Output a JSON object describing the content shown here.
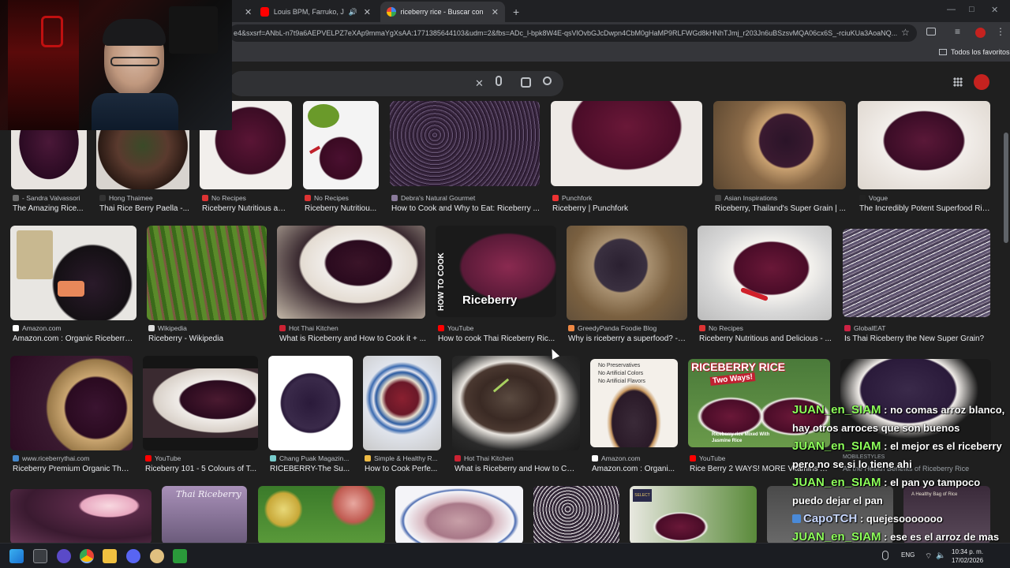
{
  "browser": {
    "tabs": [
      {
        "label": "",
        "close": "✕"
      },
      {
        "label": "Louis BPM, Farruko, J Balvin",
        "close": "✕"
      },
      {
        "label": "riceberry rice - Buscar con Goo",
        "close": "✕"
      }
    ],
    "new_tab": "+",
    "url": "e4&sxsrf=ANbL-n7t9a6AEPVELPZ7eXAp9mmaYgXsAA:1771385644103&udm=2&fbs=ADc_l-bpk8W4E-qsVlOvbGJcDwpn4CbM0gHaMP9RLFWGd8kHNhTJmj_r203Jn6uBSzsvMQA06cx6S_-rciuKUa3AoaNQ...",
    "bookmarks_label": "Todos los favoritos"
  },
  "search": {
    "clear": "✕"
  },
  "results": [
    {
      "source": "- Sandra Valvassori",
      "title": "The Amazing Rice..."
    },
    {
      "source": "Hong Thaimee",
      "title": "Thai Rice Berry Paella -..."
    },
    {
      "source": "No Recipes",
      "title": "Riceberry Nutritious an..."
    },
    {
      "source": "No Recipes",
      "title": "Riceberry Nutritiou..."
    },
    {
      "source": "Debra's Natural Gourmet",
      "title": "How to Cook and Why to Eat: Riceberry ..."
    },
    {
      "source": "Punchfork",
      "title": "Riceberry | Punchfork"
    },
    {
      "source": "Asian Inspirations",
      "title": "Riceberry, Thailand's Super Grain | ..."
    },
    {
      "source": "Vogue",
      "title": "The Incredibly Potent Superfood Ric..."
    },
    {
      "source": "Amazon.com",
      "title": "Amazon.com : Organic Riceberry ..."
    },
    {
      "source": "Wikipedia",
      "title": "Riceberry - Wikipedia"
    },
    {
      "source": "Hot Thai Kitchen",
      "title": "What is Riceberry and How to Cook it + ..."
    },
    {
      "source": "YouTube",
      "title": "How to cook Thai Riceberry Ric..."
    },
    {
      "source": "GreedyPanda Foodie Blog",
      "title": "Why is riceberry a superfood? - ..."
    },
    {
      "source": "No Recipes",
      "title": "Riceberry Nutritious and Delicious - ..."
    },
    {
      "source": "GlobalEAT",
      "title": "Is Thai Riceberry the New Super Grain?"
    },
    {
      "source": "www.riceberrythai.com",
      "title": "Riceberry Premium Organic Thai..."
    },
    {
      "source": "YouTube",
      "title": "Riceberry 101 - 5 Colours of T..."
    },
    {
      "source": "Chang Puak Magazin...",
      "title": "RICEBERRY-The Su..."
    },
    {
      "source": "Simple & Healthy R...",
      "title": "How to Cook Perfe..."
    },
    {
      "source": "Hot Thai Kitchen",
      "title": "What is Riceberry and How to Coo..."
    },
    {
      "source": "Amazon.com",
      "title": "Amazon.com : Organi..."
    },
    {
      "source": "YouTube",
      "title": "Rice Berry 2 WAYS! MORE Vitamins A..."
    },
    {
      "source": "",
      "title": ""
    },
    {
      "source": "",
      "title": ""
    },
    {
      "source": "",
      "title": ""
    },
    {
      "source": "",
      "title": ""
    },
    {
      "source": "",
      "title": ""
    },
    {
      "source": "",
      "title": ""
    },
    {
      "source": "",
      "title": ""
    }
  ],
  "overlays": {
    "how_to_cook": "HOW TO COOK",
    "riceberry": "Riceberry",
    "riceberry_rice": "RICEBERRY RICE",
    "two_ways": "Two Ways!",
    "preservatives": "No Preservatives",
    "artificial_colors": "No Artificial Colors",
    "artificial_flavors": "No Artificial Flavors",
    "thai_riceberry": "Thai Riceberry",
    "mixed_jasmine": "Riceberry rice Mixed With Jasmine Rice",
    "mobilestyles": "MOBILESTYLES",
    "all_health": "All the Health Benefits of Riceberry Rice",
    "healthy_bag": "A Healthy Bag of Rice",
    "select": "SELECT"
  },
  "chat": [
    {
      "user": "JUAN_en_SIAM",
      "text": " : no comas arroz blanco, hay otros arroces que son buenos"
    },
    {
      "user": "JUAN_en_SIAM",
      "text": " : el mejor es el riceberry pero no se si lo tiene ahi"
    },
    {
      "user": "JUAN_en_SIAM",
      "text": " : el pan yo tampoco puedo dejar el pan"
    },
    {
      "user": "CapoTCH",
      "text": " : quejesooooooo"
    },
    {
      "user": "JUAN_en_SIAM",
      "text": " : ese es el arroz de mas calidad que hay"
    }
  ],
  "taskbar": {
    "lang": "ENG",
    "time": "10:34 p. m.",
    "date": "17/02/2026"
  },
  "colors": {
    "rice": "#3b1530",
    "accent": "#8ab4f8",
    "chat_user": "#8dff5a"
  }
}
